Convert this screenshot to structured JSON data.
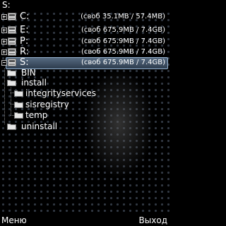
{
  "title": "S:",
  "drives": [
    {
      "label": "C:",
      "info": "(своб 35.1MB / 57.4MB)",
      "selected": false
    },
    {
      "label": "E:",
      "info": "(своб 675.9MB / 7.4GB)",
      "selected": false
    },
    {
      "label": "P:",
      "info": "(своб 675.9MB / 7.4GB)",
      "selected": false
    },
    {
      "label": "R:",
      "info": "(своб 675.9MB / 7.4GB)",
      "selected": false
    },
    {
      "label": "S:",
      "info": "(своб 675.9MB / 7.4GB)",
      "selected": true
    }
  ],
  "folders": [
    {
      "label": "BIN",
      "level": 1
    },
    {
      "label": "install",
      "level": 1
    },
    {
      "label": "integrityservices",
      "level": 2
    },
    {
      "label": "sisregistry",
      "level": 2
    },
    {
      "label": "temp",
      "level": 2
    },
    {
      "label": "uninstall",
      "level": 1
    }
  ],
  "softkeys": {
    "left": "Меню",
    "right": "Выход"
  }
}
